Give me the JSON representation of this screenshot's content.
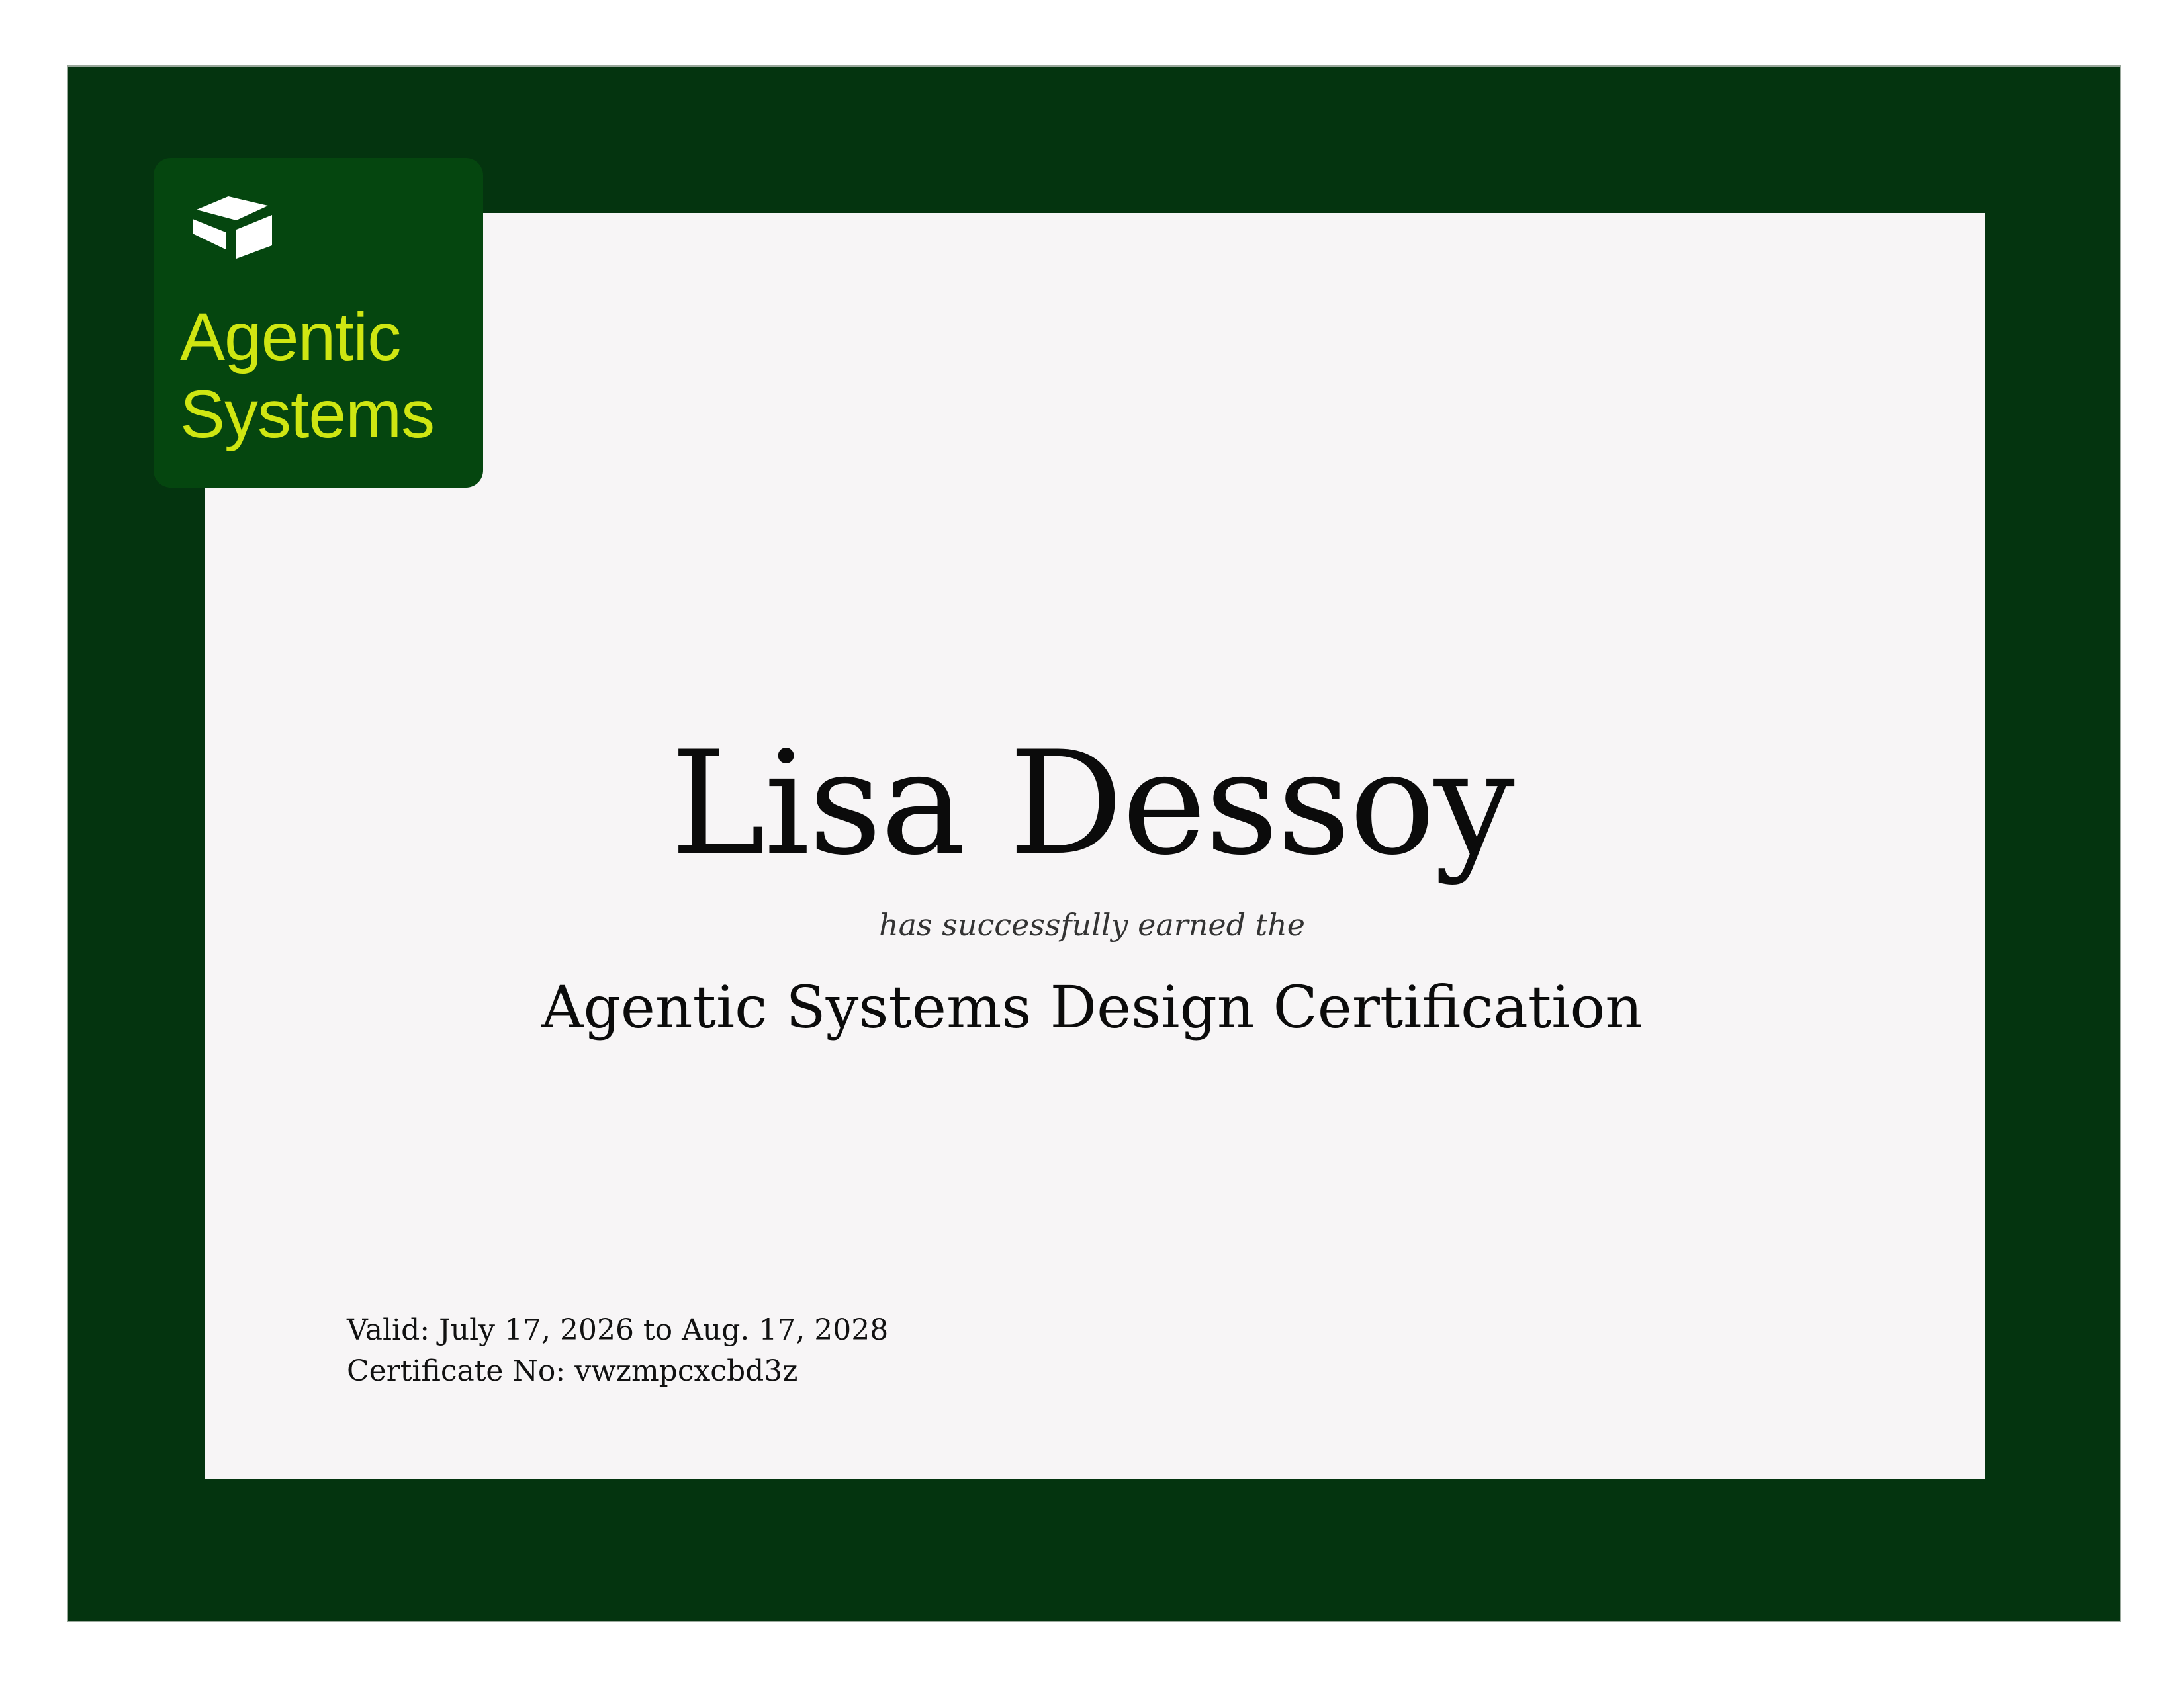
{
  "logo": {
    "icon": "open-box-icon",
    "line1": "Agentic",
    "line2": "Systems"
  },
  "certificate": {
    "recipient": "Lisa Dessoy",
    "earned_text": "has successfully earned the",
    "title": "Agentic Systems Design Certification",
    "valid_label": "Valid:",
    "valid_range": "July 17, 2026 to Aug. 17, 2028",
    "cert_no_label": "Certificate No:",
    "cert_no": "vwzmpcxcbd3z"
  },
  "colors": {
    "frame": "#04340f",
    "panel": "#f7f5f6",
    "logo_bg": "#05460f",
    "logo_text": "#cfe612"
  }
}
